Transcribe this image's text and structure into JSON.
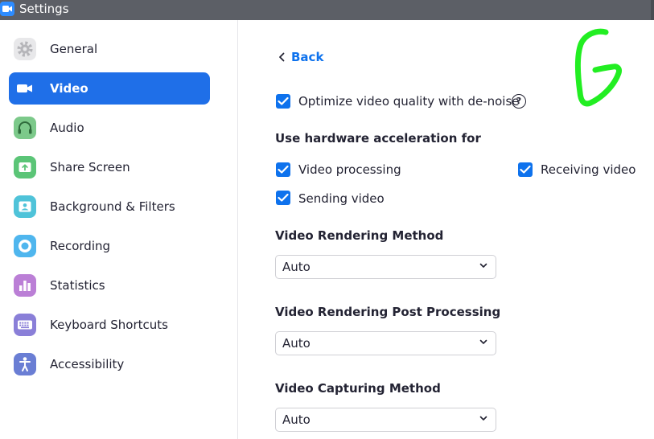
{
  "window": {
    "title": "Settings"
  },
  "sidebar": {
    "items": [
      {
        "label": "General",
        "icon": "gear-icon",
        "color": "#e8e8ea",
        "active": false
      },
      {
        "label": "Video",
        "icon": "video-camera-icon",
        "color": "#1f6fe8",
        "active": true
      },
      {
        "label": "Audio",
        "icon": "headphones-icon",
        "color": "#7cc98a",
        "active": false
      },
      {
        "label": "Share Screen",
        "icon": "share-screen-icon",
        "color": "#5bc577",
        "active": false
      },
      {
        "label": "Background & Filters",
        "icon": "background-person-icon",
        "color": "#4fc3d9",
        "active": false
      },
      {
        "label": "Recording",
        "icon": "record-icon",
        "color": "#4fb6ee",
        "active": false
      },
      {
        "label": "Statistics",
        "icon": "bar-chart-icon",
        "color": "#bb7fd6",
        "active": false
      },
      {
        "label": "Keyboard Shortcuts",
        "icon": "keyboard-icon",
        "color": "#8a7fd8",
        "active": false
      },
      {
        "label": "Accessibility",
        "icon": "accessibility-person-icon",
        "color": "#6a7ed4",
        "active": false
      }
    ]
  },
  "main": {
    "back_label": "Back",
    "denoise": {
      "label": "Optimize video quality with de-noise",
      "checked": true,
      "help": "?"
    },
    "hw_accel": {
      "title": "Use hardware acceleration for",
      "video_processing": {
        "label": "Video processing",
        "checked": true
      },
      "receiving_video": {
        "label": "Receiving video",
        "checked": true
      },
      "sending_video": {
        "label": "Sending video",
        "checked": true
      }
    },
    "rendering_method": {
      "title": "Video Rendering Method",
      "value": "Auto"
    },
    "rendering_post": {
      "title": "Video Rendering Post Processing",
      "value": "Auto"
    },
    "capturing_method": {
      "title": "Video Capturing Method",
      "value": "Auto"
    }
  },
  "colors": {
    "accent": "#0e72ed",
    "active_nav": "#1f6fe8",
    "titlebar": "#5c5f66",
    "scribble": "#22ee22"
  }
}
